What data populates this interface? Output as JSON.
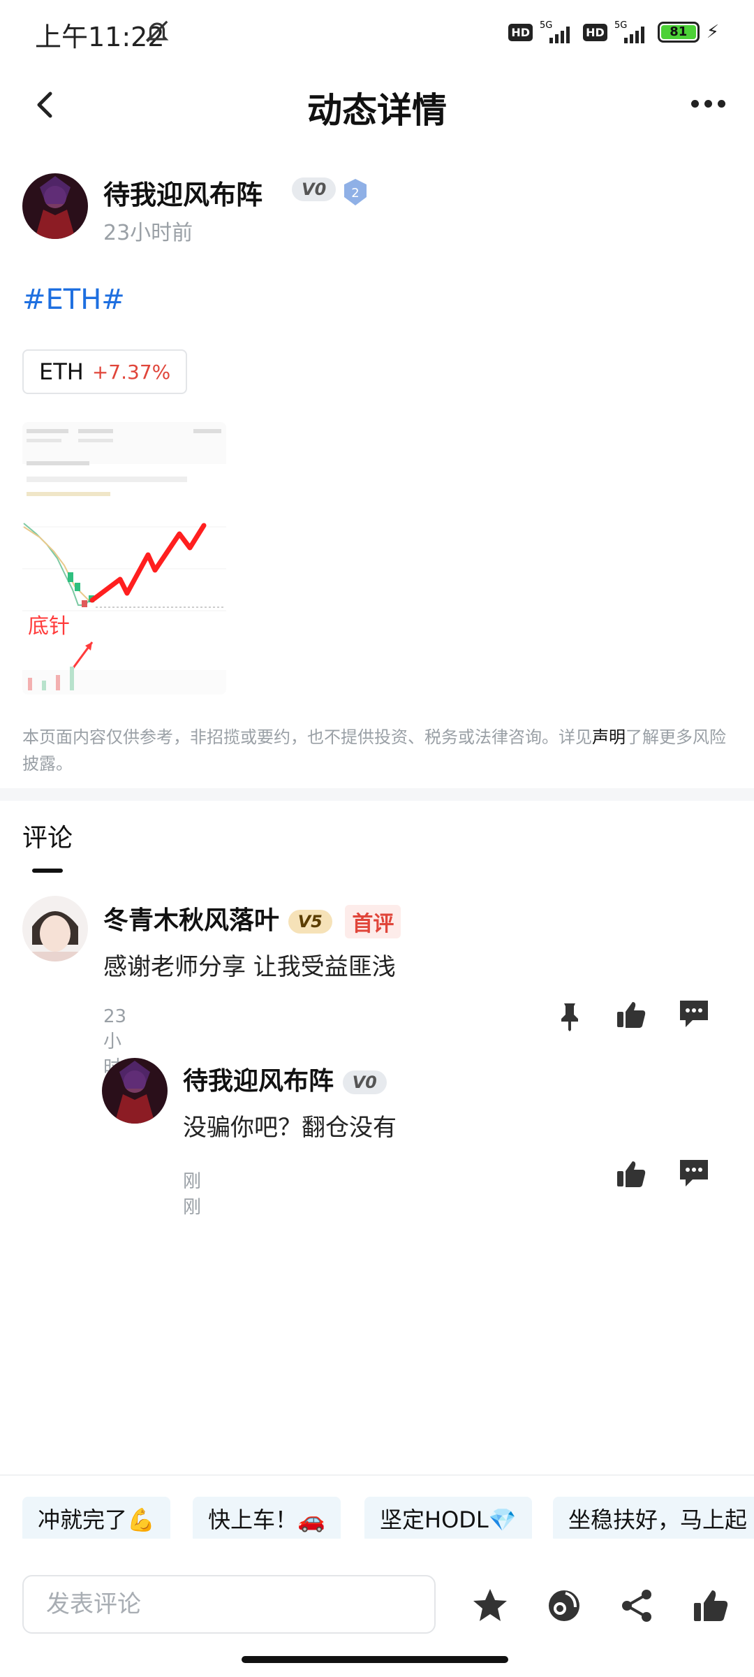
{
  "status_bar": {
    "time": "上午11:22",
    "hd1": "HD",
    "net1": "5G",
    "hd2": "HD",
    "net2": "5G",
    "battery": "81"
  },
  "header": {
    "title": "动态详情"
  },
  "author": {
    "name": "待我迎风布阵",
    "level": "V0",
    "shield_level": "2",
    "time": "23小时前"
  },
  "post": {
    "hashtag": "#ETH#",
    "coin": {
      "name": "ETH",
      "change": "+7.37%"
    },
    "image_label": "底针",
    "disclaimer_pre": "本页面内容仅供参考，非招揽或要约，也不提供投资、税务或法律咨询。详见",
    "disclaimer_link": "声明",
    "disclaimer_post": "了解更多风险披露。"
  },
  "comments_section": {
    "tab_label": "评论",
    "comments": [
      {
        "name": "冬青木秋风落叶",
        "level": "V5",
        "badge": "首评",
        "text": "感谢老师分享 让我受益匪浅",
        "time": "23小时前"
      }
    ],
    "reply": {
      "name": "待我迎风布阵",
      "level": "V0",
      "text": "没骗你吧？翻仓没有",
      "time": "刚刚"
    }
  },
  "quick_replies": [
    "冲就完了💪",
    "快上车！🚗",
    "坚定HODL💎",
    "坐稳扶好，马上起"
  ],
  "bottom_bar": {
    "input_placeholder": "发表评论"
  },
  "colors": {
    "accent_blue": "#1e6fe0",
    "up_red": "#e0453a",
    "battery_green": "#4cd137"
  }
}
